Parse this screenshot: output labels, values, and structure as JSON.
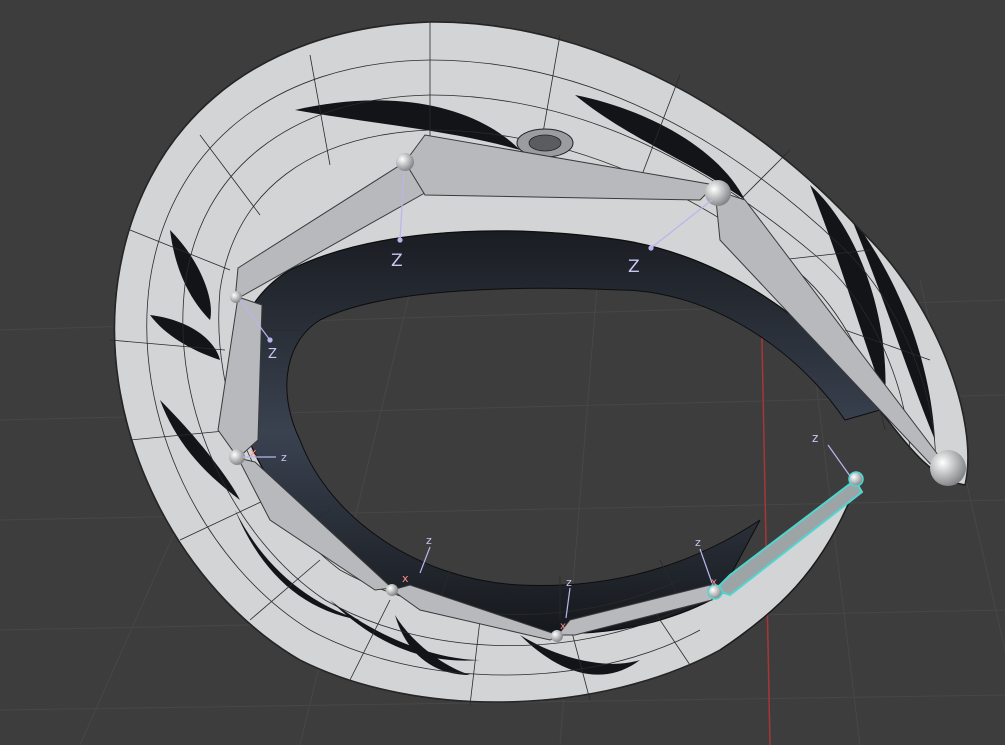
{
  "viewport": {
    "background": "#3d3d3d",
    "grid_color": "#4a4a4a",
    "grid_axis_color": "#b03a3a"
  },
  "mesh": {
    "color": "#d7d9db",
    "edge_color": "#1c1c1c",
    "inner_color": "#20242a"
  },
  "armature": {
    "bone_color": "#b9bbbe",
    "selected_color": "#4fd6d0"
  },
  "axes": {
    "z_large": "Z",
    "z_small": "z",
    "x_small": "x"
  }
}
